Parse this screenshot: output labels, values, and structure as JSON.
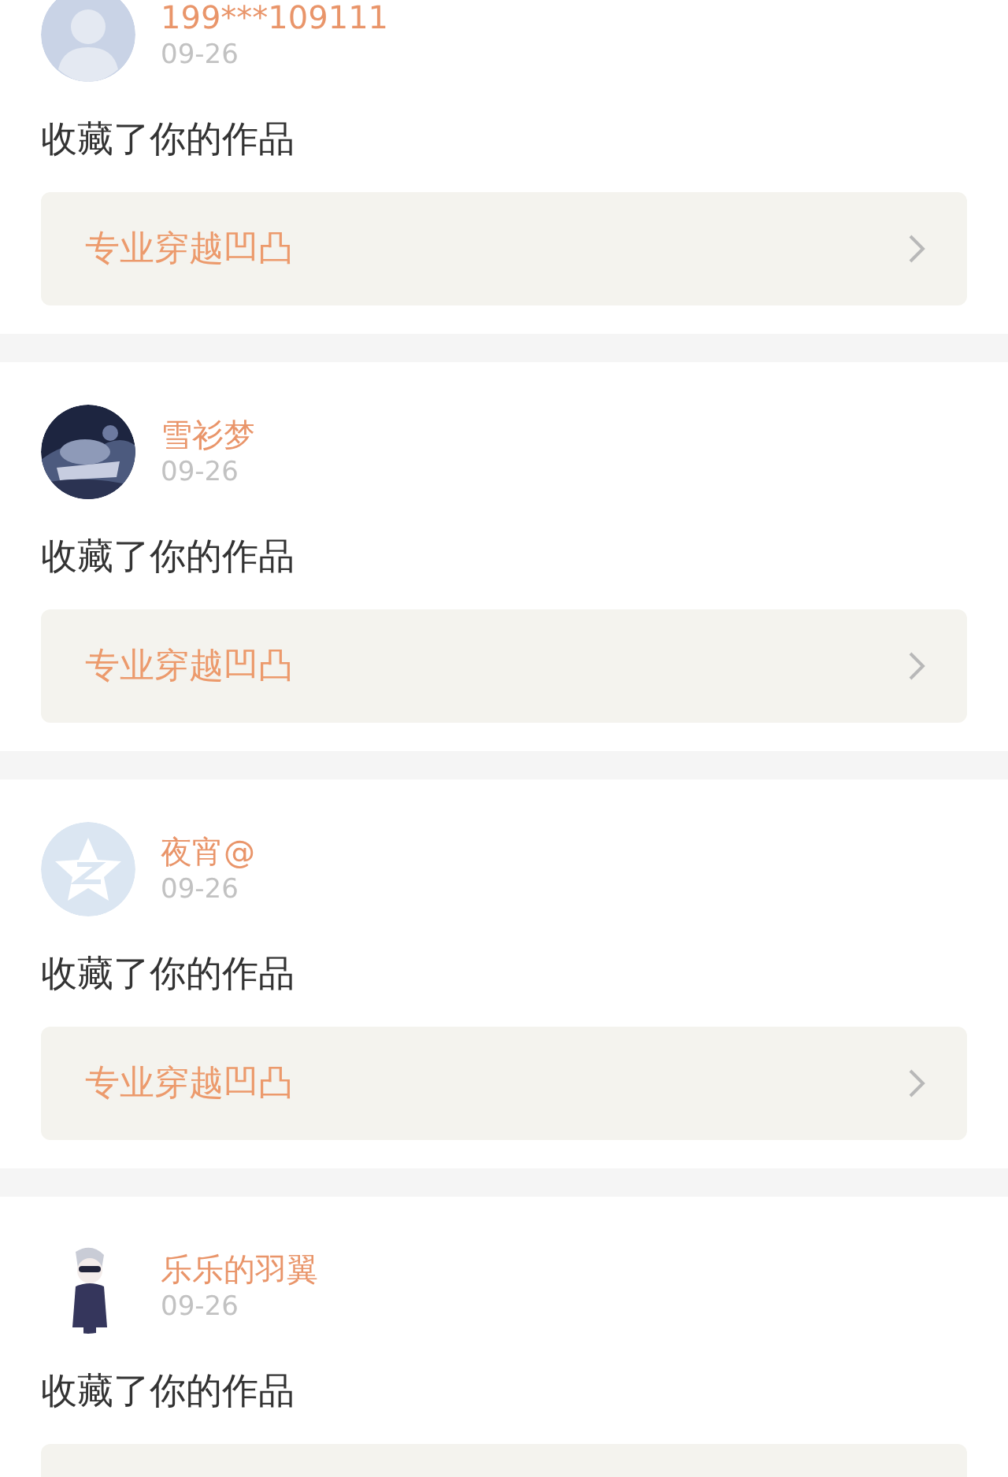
{
  "notifications": [
    {
      "avatar": {
        "kind": "default"
      },
      "name": "199***109111",
      "date": "09-26",
      "action": "收藏了你的作品",
      "work_title": "专业穿越凹凸"
    },
    {
      "name": "雪衫梦",
      "date": "09-26",
      "action": "收藏了你的作品",
      "work_title": "专业穿越凹凸"
    },
    {
      "avatar": {
        "kind": "star"
      },
      "name": "夜宵@",
      "date": "09-26",
      "action": "收藏了你的作品",
      "work_title": "专业穿越凹凸"
    },
    {
      "avatar": {
        "kind": "figure"
      },
      "name": "乐乐的羽翼",
      "date": "09-26",
      "action": "收藏了你的作品"
    }
  ]
}
